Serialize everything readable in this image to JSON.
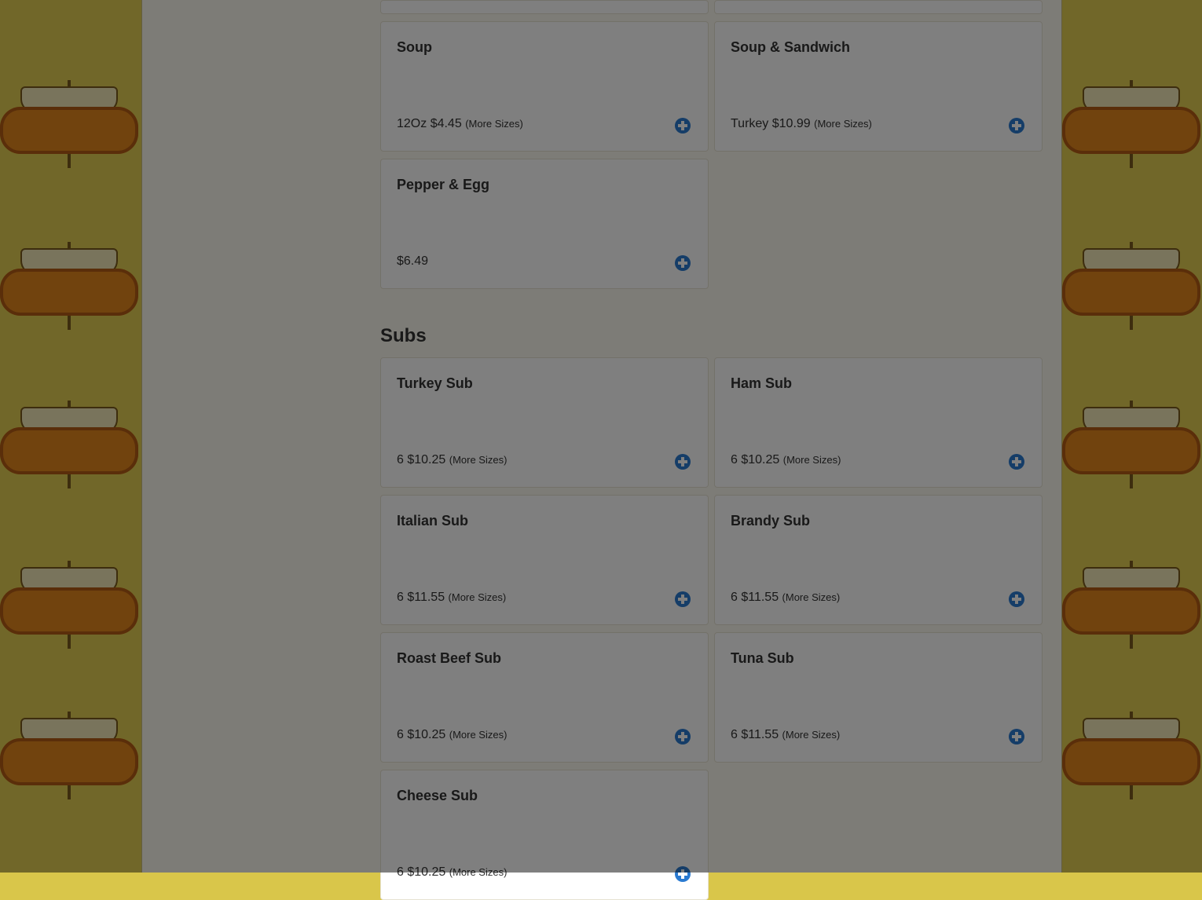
{
  "sections": [
    {
      "title": ""
    },
    {
      "title": "Subs"
    }
  ],
  "items": {
    "soup": {
      "name": "Soup",
      "price": "12Oz $4.45",
      "more": "(More Sizes)"
    },
    "soup_sandwich": {
      "name": "Soup & Sandwich",
      "price": "Turkey $10.99",
      "more": "(More Sizes)"
    },
    "pepper_egg": {
      "name": "Pepper & Egg",
      "price": "$6.49",
      "more": ""
    },
    "turkey_sub": {
      "name": "Turkey Sub",
      "price": "6 $10.25",
      "more": "(More Sizes)"
    },
    "ham_sub": {
      "name": "Ham Sub",
      "price": "6 $10.25",
      "more": "(More Sizes)"
    },
    "italian_sub": {
      "name": "Italian Sub",
      "price": "6 $11.55",
      "more": "(More Sizes)"
    },
    "brandy_sub": {
      "name": "Brandy Sub",
      "price": "6 $11.55",
      "more": "(More Sizes)"
    },
    "roast_beef_sub": {
      "name": "Roast Beef Sub",
      "price": "6 $10.25",
      "more": "(More Sizes)"
    },
    "tuna_sub": {
      "name": "Tuna Sub",
      "price": "6 $11.55",
      "more": "(More Sizes)"
    },
    "cheese_sub": {
      "name": "Cheese Sub",
      "price": "6 $10.25",
      "more": "(More Sizes)"
    }
  },
  "colors": {
    "accent": "#2a7ad1",
    "wallpaper": "#e2cf52",
    "logo_orange": "#e2871d"
  },
  "icons": {
    "add": "plus-circle-icon"
  }
}
